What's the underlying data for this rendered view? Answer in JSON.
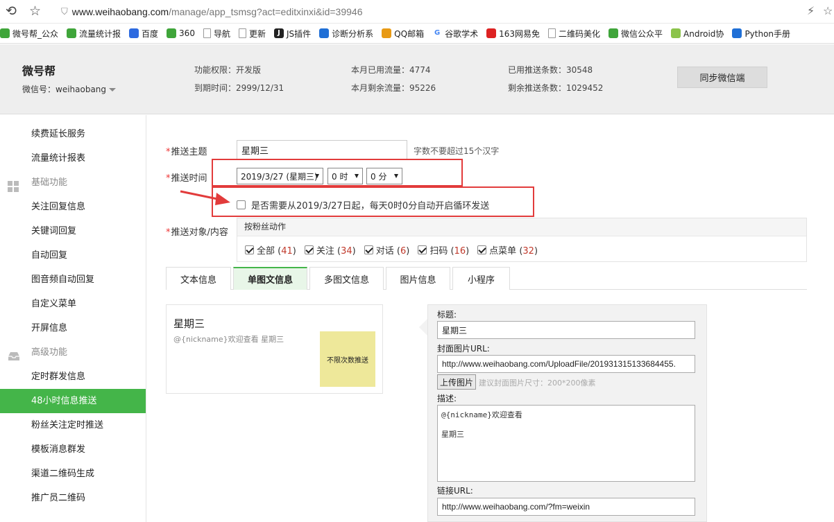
{
  "browser": {
    "url_host": "www.weihaobang.com",
    "url_path": "/manage/app_tsmsg?act=editxinxi&id=39946",
    "bookmarks": [
      {
        "label": "微号帮_公众",
        "icon": "green"
      },
      {
        "label": "流量统计报",
        "icon": "green"
      },
      {
        "label": "百度",
        "icon": "baidu"
      },
      {
        "label": "360",
        "icon": "green"
      },
      {
        "label": "导航",
        "icon": "page"
      },
      {
        "label": "更新",
        "icon": "page"
      },
      {
        "label": "JS插件",
        "icon": "js"
      },
      {
        "label": "诊断分析系",
        "icon": "blue"
      },
      {
        "label": "QQ邮箱",
        "icon": "qq"
      },
      {
        "label": "谷歌学术",
        "icon": "g"
      },
      {
        "label": "163网易免",
        "icon": "red"
      },
      {
        "label": "二维码美化",
        "icon": "page"
      },
      {
        "label": "微信公众平",
        "icon": "green"
      },
      {
        "label": "Android协",
        "icon": "lime"
      },
      {
        "label": "Python手册",
        "icon": "blue"
      }
    ]
  },
  "header": {
    "brand": "微号帮",
    "account": "微信号：weihaobang",
    "perm": "功能权限：开发版",
    "expire": "到期时间：2999/12/31",
    "used_flow": "本月已用流量：4774",
    "left_flow": "本月剩余流量：95226",
    "pushed": "已用推送条数：30548",
    "left_push": "剩余推送条数：1029452",
    "sync_button": "同步微信端"
  },
  "sidebar": {
    "items": [
      {
        "label": "续费延长服务",
        "type": "item"
      },
      {
        "label": "流量统计报表",
        "type": "item"
      },
      {
        "label": "基础功能",
        "type": "group"
      },
      {
        "label": "关注回复信息",
        "type": "item"
      },
      {
        "label": "关键词回复",
        "type": "item"
      },
      {
        "label": "自动回复",
        "type": "item"
      },
      {
        "label": "图音频自动回复",
        "type": "item"
      },
      {
        "label": "自定义菜单",
        "type": "item"
      },
      {
        "label": "开屏信息",
        "type": "item"
      },
      {
        "label": "高级功能",
        "type": "group"
      },
      {
        "label": "定时群发信息",
        "type": "item"
      },
      {
        "label": "48小时信息推送",
        "type": "active"
      },
      {
        "label": "粉丝关注定时推送",
        "type": "item"
      },
      {
        "label": "模板消息群发",
        "type": "item"
      },
      {
        "label": "渠道二维码生成",
        "type": "item"
      },
      {
        "label": "推广员二维码",
        "type": "item"
      }
    ]
  },
  "form": {
    "subject_label": "推送主题",
    "subject_value": "星期三",
    "subject_hint": "字数不要超过15个汉字",
    "time_label": "推送时间",
    "date_value": "2019/3/27 (星期三)",
    "hour_value": "0 时",
    "minute_value": "0 分",
    "loop_label": "是否需要从2019/3/27日起，每天0时0分自动开启循环发送",
    "target_label": "推送对象/内容",
    "target_group": "按粉丝动作",
    "targets": [
      {
        "label": "全部",
        "count": "41"
      },
      {
        "label": "关注",
        "count": "34"
      },
      {
        "label": "对话",
        "count": "6"
      },
      {
        "label": "扫码",
        "count": "16"
      },
      {
        "label": "点菜单",
        "count": "32"
      }
    ]
  },
  "tabs": [
    "文本信息",
    "单图文信息",
    "多图文信息",
    "图片信息",
    "小程序"
  ],
  "preview": {
    "title": "星期三",
    "desc": "@{nickname}欢迎查看 星期三",
    "thumb": "不限次数推送"
  },
  "editor": {
    "title_label": "标题:",
    "title_value": "星期三",
    "cover_label": "封面图片URL:",
    "cover_value": "http://www.weihaobang.com/UploadFile/201931315133684455.",
    "upload_button": "上传图片",
    "upload_hint": "建议封面图片尺寸：200*200像素",
    "desc_label": "描述:",
    "desc_line1": "@{nickname}欢迎查看",
    "desc_line2": "星期三",
    "link_label": "链接URL:",
    "link_value": "http://www.weihaobang.com/?fm=weixin"
  },
  "colors": {
    "accent": "#44b549",
    "annotation": "#e23b3b"
  }
}
